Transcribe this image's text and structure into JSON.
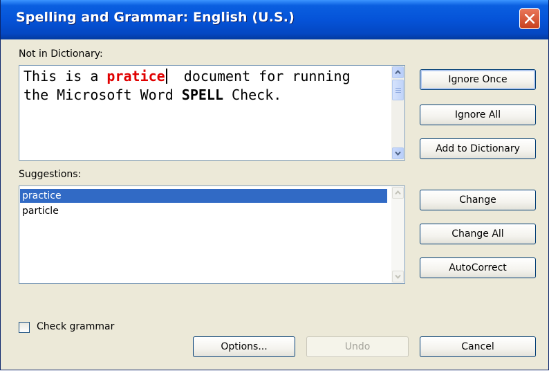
{
  "window": {
    "title": "Spelling and Grammar: English (U.S.)"
  },
  "not_in_dictionary": {
    "label": "Not in Dictionary:",
    "text_segments": [
      {
        "text": "This is a ",
        "style": "normal"
      },
      {
        "text": "pratice",
        "style": "error"
      },
      {
        "text": "  document for running the Microsoft Word ",
        "style": "normal"
      },
      {
        "text": "SPELL",
        "style": "bold"
      },
      {
        "text": " Check.",
        "style": "normal"
      }
    ]
  },
  "suggestions": {
    "label": "Suggestions:",
    "items": [
      "practice",
      "particle"
    ],
    "selected_index": 0
  },
  "buttons": {
    "ignore_once": "Ignore Once",
    "ignore_all": "Ignore All",
    "add_to_dictionary": "Add to Dictionary",
    "change": "Change",
    "change_all": "Change All",
    "autocorrect": "AutoCorrect",
    "options": "Options...",
    "undo": "Undo",
    "cancel": "Cancel"
  },
  "check_grammar": {
    "label": "Check grammar",
    "checked": false
  },
  "colors": {
    "titlebar": "#0553d8",
    "selection": "#316ac5",
    "error_text": "#e00000",
    "dialog_bg": "#ece9d8"
  }
}
